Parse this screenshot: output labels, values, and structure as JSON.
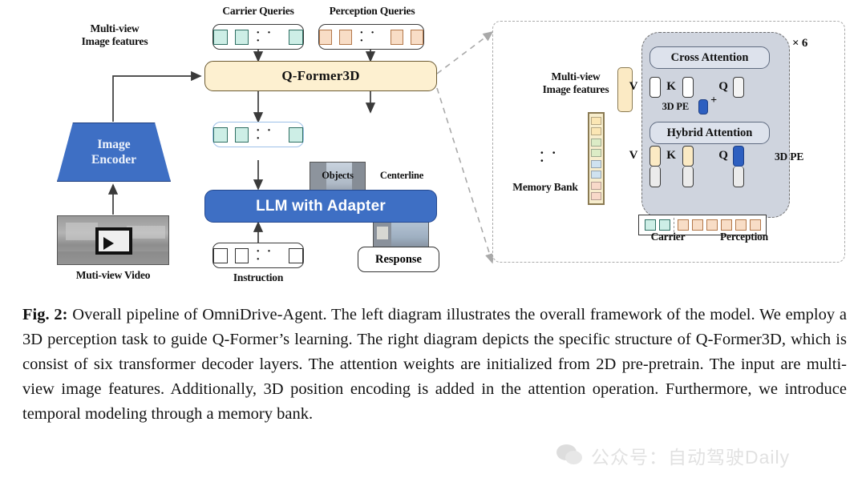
{
  "figure": {
    "left_diagram": {
      "carrier_queries_label": "Carrier Queries",
      "perception_queries_label": "Perception Queries",
      "multiview_label_line1": "Multi-view",
      "multiview_label_line2": "Image features",
      "qformer_label": "Q-Former3D",
      "image_encoder_line1": "Image",
      "image_encoder_line2": "Encoder",
      "video_label": "Muti-view Video",
      "objects_label": "Objects",
      "centerline_label": "Centerline",
      "llm_label": "LLM with Adapter",
      "instruction_label": "Instruction",
      "response_label": "Response",
      "dots": "· · ·",
      "carrier_token_count": 3,
      "perception_token_count": 4,
      "selected_token_count": 3,
      "instruction_token_count": 3
    },
    "right_diagram": {
      "repeat_label": "× 6",
      "multiview_label_line1": "Multi-view",
      "multiview_label_line2": "Image features",
      "memory_bank_label": "Memory Bank",
      "memory_dots": "· · ·",
      "cross_attention_label": "Cross Attention",
      "hybrid_attention_label": "Hybrid Attention",
      "pe_label_top": "3D PE",
      "pe_label_right": "3D PE",
      "plus_sign": "+",
      "cross_v": "V",
      "cross_k": "K",
      "cross_q": "Q",
      "hybrid_v": "V",
      "hybrid_k": "K",
      "hybrid_q": "Q",
      "carrier_label": "Carrier",
      "perception_label": "Perception",
      "token_carrier_count": 2,
      "token_perception_count": 6,
      "memory_cells": [
        "#fbe6b4",
        "#fbe6b4",
        "#dcecc6",
        "#dcecc6",
        "#cfe2f0",
        "#cfe2f0",
        "#f8d9c9",
        "#f8d9c9"
      ]
    },
    "colors": {
      "blue": "#3e6fc4",
      "cream": "#fdf0d0",
      "teal_token": "#cdeee6",
      "peach_token": "#f8ddc6",
      "gray_block": "#cfd4de",
      "attention_block": "#dde2ec",
      "pe_blue": "#2d5fc0"
    }
  },
  "caption": {
    "prefix": "Fig. 2:",
    "text": " Overall pipeline of OmniDrive-Agent. The left diagram illustrates the overall framework of the model. We employ a 3D perception task to guide Q-Former’s learning. The right diagram depicts the specific structure of Q-Former3D, which is consist of six transformer decoder layers. The attention weights are initialized from 2D pre-pretrain. The input are multi-view image features. Additionally, 3D position encoding is added in the attention operation. Furthermore, we introduce temporal modeling through a memory bank."
  },
  "watermark": {
    "text": "公众号：自动驾驶Daily"
  }
}
